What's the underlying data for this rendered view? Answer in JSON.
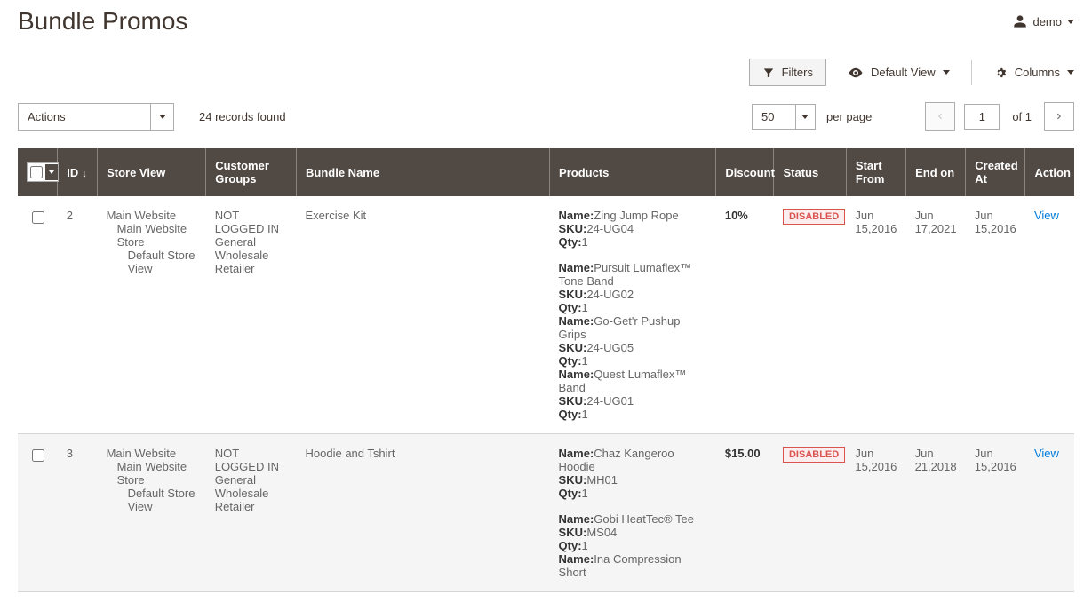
{
  "header": {
    "title": "Bundle Promos",
    "user": "demo"
  },
  "toolbar": {
    "filters_label": "Filters",
    "default_view_label": "Default View",
    "columns_label": "Columns"
  },
  "controls": {
    "actions_label": "Actions",
    "records_found": "24 records found",
    "per_page_value": "50",
    "per_page_label": "per page",
    "current_page": "1",
    "of_pages": "of 1"
  },
  "columns": {
    "id": "ID",
    "store_view": "Store View",
    "customer_groups": "Customer Groups",
    "bundle_name": "Bundle Name",
    "products": "Products",
    "discount": "Discount",
    "status": "Status",
    "start_from": "Start From",
    "end_on": "End on",
    "created_at": "Created At",
    "action": "Action"
  },
  "labels": {
    "name": "Name:",
    "sku": "SKU:",
    "qty": "Qty:",
    "view": "View"
  },
  "rows": [
    {
      "id": "2",
      "store_view": {
        "l1": "Main Website",
        "l2": "Main Website Store",
        "l3": "Default Store View"
      },
      "customer_groups": [
        "NOT LOGGED IN",
        "General",
        "Wholesale",
        "Retailer"
      ],
      "bundle_name": "Exercise Kit",
      "products": [
        [
          {
            "name": "Zing Jump Rope",
            "sku": "24-UG04",
            "qty": "1"
          }
        ],
        [
          {
            "name": "Pursuit Lumaflex™ Tone Band",
            "sku": "24-UG02",
            "qty": "1"
          },
          {
            "name": "Go-Get'r Pushup Grips",
            "sku": "24-UG05",
            "qty": "1"
          },
          {
            "name": "Quest Lumaflex™ Band",
            "sku": "24-UG01",
            "qty": "1"
          }
        ]
      ],
      "discount": "10%",
      "status": "DISABLED",
      "start_from": "Jun 15,2016",
      "end_on": "Jun 17,2021",
      "created_at": "Jun 15,2016"
    },
    {
      "id": "3",
      "store_view": {
        "l1": "Main Website",
        "l2": "Main Website Store",
        "l3": "Default Store View"
      },
      "customer_groups": [
        "NOT LOGGED IN",
        "General",
        "Wholesale",
        "Retailer"
      ],
      "bundle_name": "Hoodie and Tshirt",
      "products": [
        [
          {
            "name": "Chaz Kangeroo Hoodie",
            "sku": "MH01",
            "qty": "1"
          }
        ],
        [
          {
            "name": "Gobi HeatTec® Tee",
            "sku": "MS04",
            "qty": "1"
          },
          {
            "name": "Ina Compression Short"
          }
        ]
      ],
      "discount": "$15.00",
      "status": "DISABLED",
      "start_from": "Jun 15,2016",
      "end_on": "Jun 21,2018",
      "created_at": "Jun 15,2016"
    }
  ]
}
